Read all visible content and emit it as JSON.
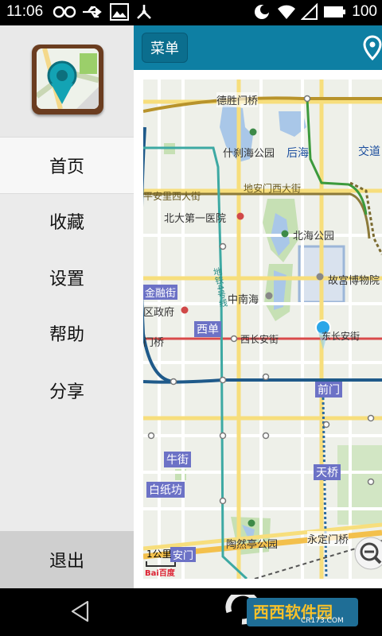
{
  "status_bar": {
    "time": "11:06",
    "battery": "100"
  },
  "drawer": {
    "items": [
      {
        "label": "首页"
      },
      {
        "label": "收藏"
      },
      {
        "label": "设置"
      },
      {
        "label": "帮助"
      },
      {
        "label": "分享"
      }
    ],
    "exit_label": "退出"
  },
  "main": {
    "menu_button_label": "菜单"
  },
  "map": {
    "labels": {
      "deshengmen": "德胜门桥",
      "shichahai": "什刹海公园",
      "houhai": "后海",
      "jiaotong": "交道",
      "pinganli": "平安里西大街",
      "dianmenxi": "地安门西大街",
      "beida": "北大第一医院",
      "beihai": "北海公园",
      "gugong": "故宫博物院",
      "zhongnanhai": "中南海",
      "jinrongjie": "金融街",
      "quzhengfu": "区政府",
      "line4": "地铁4号线",
      "xidan": "西单",
      "menqiao": "门桥",
      "xichangan": "西长安街",
      "dongchangan": "东长安街",
      "qianmen": "前门",
      "niujie": "牛街",
      "tianqiao": "天桥",
      "baizhifang": "白纸坊",
      "taoranting": "陶然亭公园",
      "yongdingmen": "永定门桥",
      "anmen": "安门",
      "scale": "1公里",
      "baidu": "Bai百度"
    }
  },
  "watermark": {
    "text": "西西软件园",
    "sub": "CR173.COM"
  },
  "colors": {
    "topbar": "#0e7fa3",
    "drawer_bg": "#ebebeb",
    "exit_bg": "#cfcfcf"
  }
}
